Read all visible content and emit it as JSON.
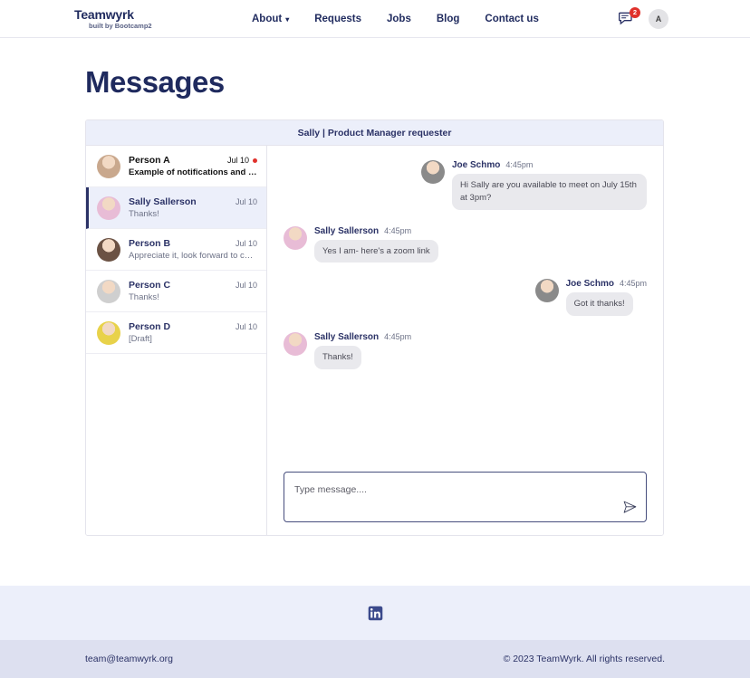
{
  "nav": {
    "brand": {
      "name": "Teamwyrk",
      "tagline": "built by Bootcamp2"
    },
    "links": [
      {
        "label": "About",
        "has_caret": true
      },
      {
        "label": "Requests",
        "has_caret": false
      },
      {
        "label": "Jobs",
        "has_caret": false
      },
      {
        "label": "Blog",
        "has_caret": false
      },
      {
        "label": "Contact us",
        "has_caret": false
      }
    ],
    "messages_badge": "2",
    "user_initial": "A"
  },
  "page": {
    "title": "Messages"
  },
  "card": {
    "header": "Sally | Product Manager requester"
  },
  "conversations": [
    {
      "name": "Person A",
      "date": "Jul 10",
      "preview": "Example of notifications and ellipse",
      "unread": true,
      "selected": false,
      "avatar_color": "#c9a88d"
    },
    {
      "name": "Sally Sallerson",
      "date": "Jul 10",
      "preview": "Thanks!",
      "unread": false,
      "selected": true,
      "avatar_color": "#e8bcd6"
    },
    {
      "name": "Person B",
      "date": "Jul 10",
      "preview": "Appreciate it, look forward to chat...",
      "unread": false,
      "selected": false,
      "avatar_color": "#6b5244"
    },
    {
      "name": "Person C",
      "date": "Jul 10",
      "preview": "Thanks!",
      "unread": false,
      "selected": false,
      "avatar_color": "#cfcfcf"
    },
    {
      "name": "Person D",
      "date": "Jul 10",
      "preview": "[Draft]",
      "unread": false,
      "selected": false,
      "avatar_color": "#e8d24a"
    }
  ],
  "messages": [
    {
      "author": "Joe Schmo",
      "time": "4:45pm",
      "text": "Hi Sally are you available to meet on July 15th at 3pm?",
      "side": "out",
      "avatar_color": "#8a8a8a"
    },
    {
      "author": "Sally Sallerson",
      "time": "4:45pm",
      "text": "Yes I am- here's a zoom link",
      "side": "in",
      "avatar_color": "#e8bcd6"
    },
    {
      "author": "Joe Schmo",
      "time": "4:45pm",
      "text": "Got it thanks!",
      "side": "out",
      "avatar_color": "#8a8a8a"
    },
    {
      "author": "Sally Sallerson",
      "time": "4:45pm",
      "text": "Thanks!",
      "side": "in",
      "avatar_color": "#e8bcd6"
    }
  ],
  "composer": {
    "placeholder": "Type message....",
    "value": "",
    "send_icon": "send-paper-plane-icon"
  },
  "footer": {
    "social_icon": "linkedin-icon",
    "email": "team@teamwyrk.org",
    "copyright": "© 2023 TeamWyrk. All rights reserved."
  },
  "colors": {
    "brand_navy": "#1f2a5e",
    "accent_lavender": "#eceffa",
    "footer_bar": "#dde0f0",
    "badge_red": "#e0312b",
    "bubble_gray": "#e9e9ed"
  }
}
